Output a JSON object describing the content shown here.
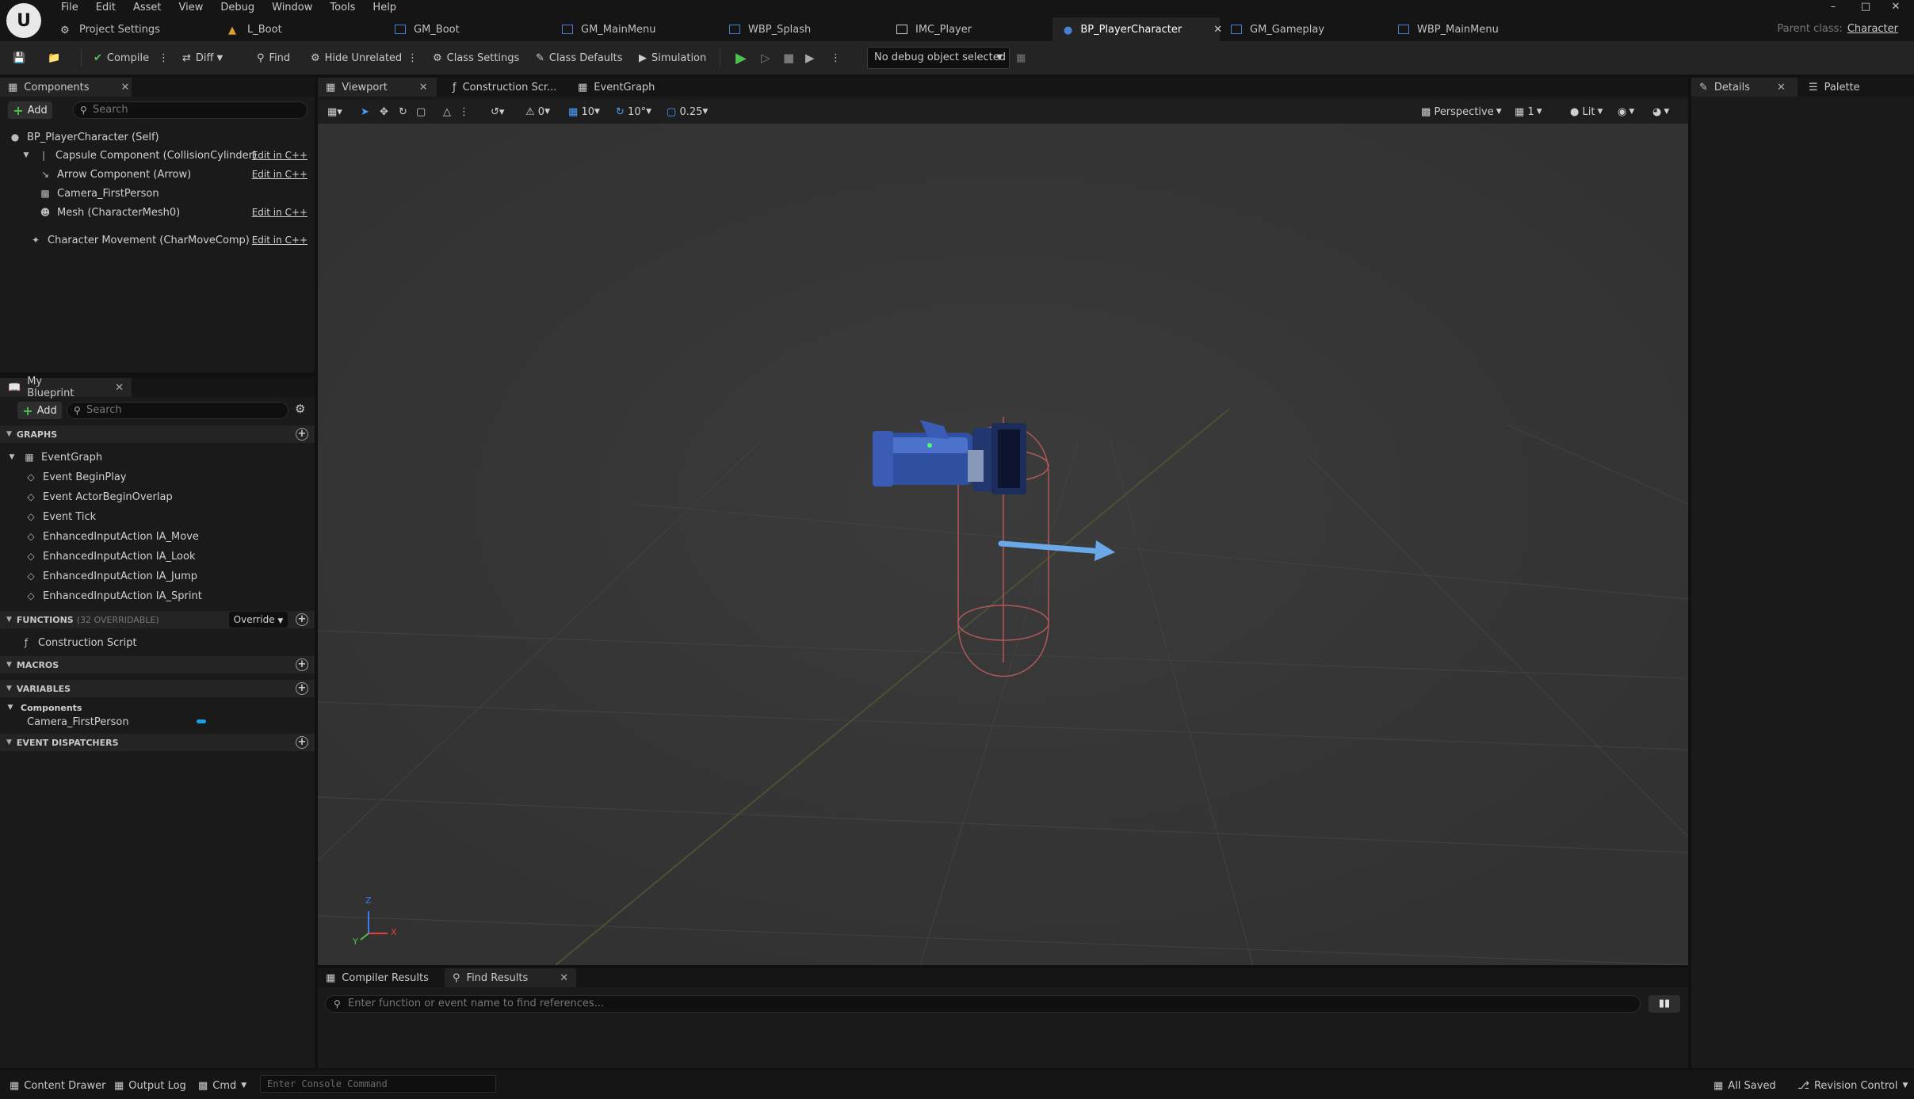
{
  "menubar": {
    "items": [
      "File",
      "Edit",
      "Asset",
      "View",
      "Debug",
      "Window",
      "Tools",
      "Help"
    ]
  },
  "doc_tabs": [
    {
      "label": "Project Settings",
      "color": "#c8c8c8"
    },
    {
      "label": "L_Boot",
      "color": "#e0a030"
    },
    {
      "label": "GM_Boot",
      "color": "#4a7fd4"
    },
    {
      "label": "GM_MainMenu",
      "color": "#4a7fd4"
    },
    {
      "label": "WBP_Splash",
      "color": "#4a7fd4"
    },
    {
      "label": "IMC_Player",
      "color": "#c8c8c8"
    },
    {
      "label": "BP_PlayerCharacter",
      "color": "#4a7fd4",
      "active": true
    },
    {
      "label": "GM_Gameplay",
      "color": "#4a7fd4"
    },
    {
      "label": "WBP_MainMenu",
      "color": "#4a7fd4"
    }
  ],
  "parent_class": {
    "label": "Parent class:",
    "value": "Character"
  },
  "toolbar": {
    "compile": "Compile",
    "diff": "Diff",
    "find": "Find",
    "hide_unrelated": "Hide Unrelated",
    "class_settings": "Class Settings",
    "class_defaults": "Class Defaults",
    "simulation": "Simulation",
    "debug_object": "No debug object selected"
  },
  "components_panel": {
    "tab": "Components",
    "add": "Add",
    "search_placeholder": "Search",
    "root": "BP_PlayerCharacter (Self)",
    "items": [
      {
        "label": "Capsule Component (CollisionCylinder)",
        "edit": "Edit in C++"
      },
      {
        "label": "Arrow Component (Arrow)",
        "edit": "Edit in C++"
      },
      {
        "label": "Camera_FirstPerson",
        "edit": ""
      },
      {
        "label": "Mesh (CharacterMesh0)",
        "edit": "Edit in C++"
      },
      {
        "label": "Character Movement (CharMoveComp)",
        "edit": "Edit in C++"
      }
    ]
  },
  "my_blueprint": {
    "tab": "My Blueprint",
    "add": "Add",
    "search_placeholder": "Search",
    "graphs_header": "GRAPHS",
    "event_graph": "EventGraph",
    "events": [
      "Event BeginPlay",
      "Event ActorBeginOverlap",
      "Event Tick",
      "EnhancedInputAction IA_Move",
      "EnhancedInputAction IA_Look",
      "EnhancedInputAction IA_Jump",
      "EnhancedInputAction IA_Sprint"
    ],
    "functions_header": "FUNCTIONS",
    "functions_count": "(32 OVERRIDABLE)",
    "override": "Override",
    "construction_script": "Construction Script",
    "macros_header": "MACROS",
    "variables_header": "VARIABLES",
    "variables_category": "Components",
    "variable": "Camera_FirstPerson",
    "event_dispatchers_header": "EVENT DISPATCHERS"
  },
  "center_tabs": {
    "viewport": "Viewport",
    "construction": "Construction Scr...",
    "event_graph": "EventGraph"
  },
  "viewport_toolbar": {
    "rot_snap": "0",
    "grid_snap": "10",
    "angle_snap": "10°",
    "scale_snap": "0.25",
    "perspective": "Perspective",
    "speed": "1",
    "lit": "Lit"
  },
  "axis": {
    "z": "Z",
    "x": "X",
    "y": "Y"
  },
  "details_panel": {
    "details_tab": "Details",
    "palette_tab": "Palette"
  },
  "bottom_panel": {
    "compiler_results": "Compiler Results",
    "find_results": "Find Results",
    "find_placeholder": "Enter function or event name to find references..."
  },
  "statusbar": {
    "content_drawer": "Content Drawer",
    "output_log": "Output Log",
    "cmd": "Cmd",
    "console_placeholder": "Enter Console Command",
    "saved": "All Saved",
    "revision": "Revision Control"
  }
}
